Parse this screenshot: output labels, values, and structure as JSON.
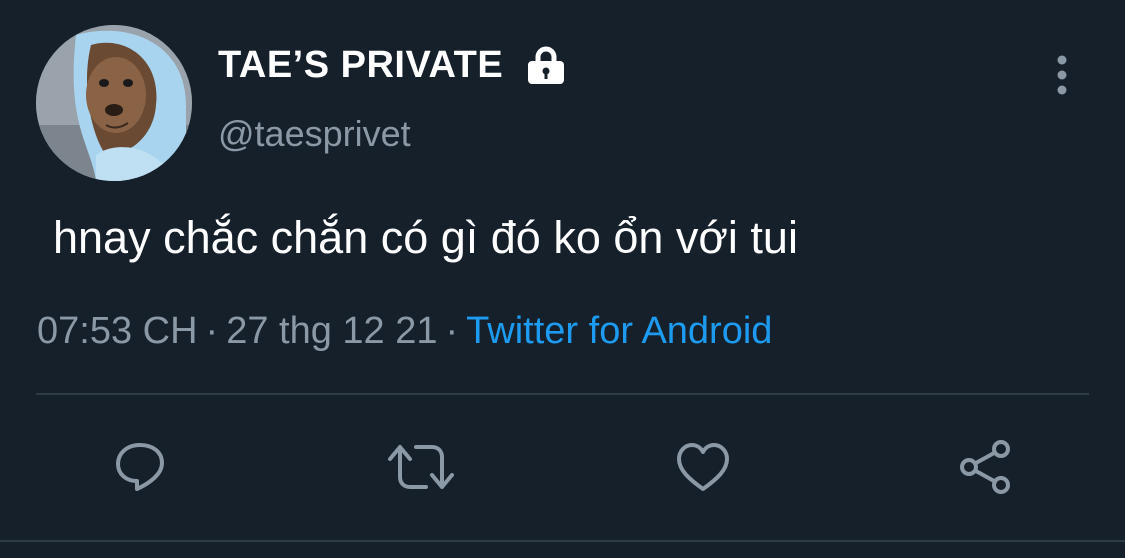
{
  "tweet": {
    "display_name": "TAE’S PRIVATE",
    "handle": "@taesprivet",
    "text": "hnay chắc chắn có gì đó ko ổn với tui",
    "time": "07:53 CH",
    "date": "27 thg 12 21",
    "separator": "·",
    "source": "Twitter for Android",
    "protected_icon": "lock-icon",
    "avatar_alt": "avatar"
  },
  "actions": [
    {
      "icon": "reply-icon"
    },
    {
      "icon": "retweet-icon"
    },
    {
      "icon": "like-icon"
    },
    {
      "icon": "share-icon"
    }
  ],
  "colors": {
    "background": "#15202b",
    "primary_text": "#ffffff",
    "secondary_text": "#8b98a5",
    "link": "#1d9bf0",
    "divider": "#2f3b47"
  }
}
